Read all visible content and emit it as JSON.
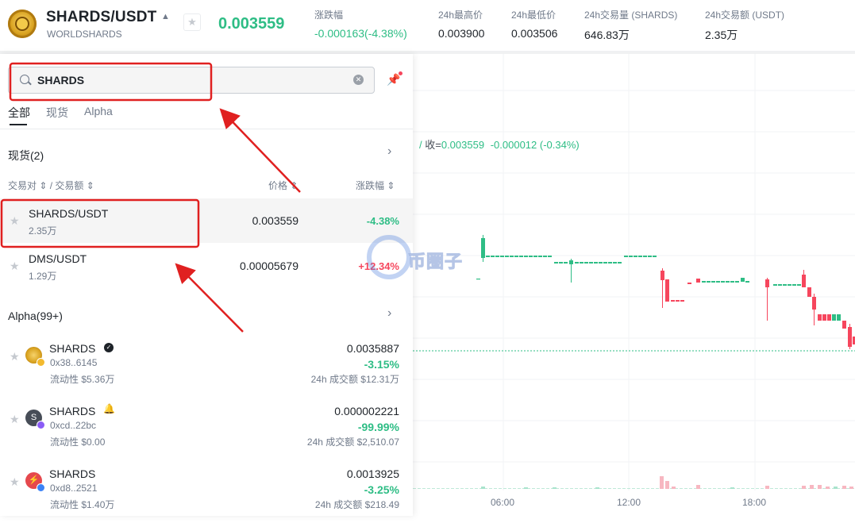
{
  "header": {
    "pair": "SHARDS/USDT",
    "project": "WORLDSHARDS",
    "last_price": "0.003559",
    "stats": [
      {
        "label": "涨跌幅",
        "value": "-0.000163(-4.38%)",
        "green": true
      },
      {
        "label": "24h最高价",
        "value": "0.003900"
      },
      {
        "label": "24h最低价",
        "value": "0.003506"
      },
      {
        "label": "24h交易量 (SHARDS)",
        "value": "646.83万"
      },
      {
        "label": "24h交易额 (USDT)",
        "value": "2.35万"
      }
    ]
  },
  "search": {
    "value": "SHARDS",
    "placeholder": ""
  },
  "tabs": [
    {
      "label": "全部",
      "active": true
    },
    {
      "label": "现货"
    },
    {
      "label": "Alpha"
    }
  ],
  "spot": {
    "title": "现货(2)",
    "headers": {
      "pair": "交易对 ⇕ / 交易额 ⇕",
      "price": "价格 ⇕",
      "change": "涨跌幅 ⇕"
    },
    "rows": [
      {
        "name": "SHARDS/USDT",
        "vol": "2.35万",
        "price": "0.003559",
        "change": "-4.38%",
        "dir": "green"
      },
      {
        "name": "DMS/USDT",
        "vol": "1.29万",
        "price": "0.00005679",
        "change": "+12.34%",
        "dir": "red"
      }
    ]
  },
  "alpha": {
    "title": "Alpha(99+)",
    "items": [
      {
        "name": "SHARDS",
        "addr": "0x38..6145",
        "liq": "流动性 $5.36万",
        "price": "0.0035887",
        "change": "-3.15%",
        "vol": "24h 成交额 $12.31万",
        "icon_color": "#d9a21f",
        "badge": "verified-icon"
      },
      {
        "name": "SHARDS",
        "addr": "0xcd..22bc",
        "liq": "流动性 $0.00",
        "price": "0.000002221",
        "change": "-99.99%",
        "vol": "24h 成交额 $2,510.07",
        "icon_color": "#474d57",
        "icon_letter": "S",
        "badge": "bell-icon"
      },
      {
        "name": "SHARDS",
        "addr": "0xd8..2521",
        "liq": "流动性 $1.40万",
        "price": "0.0013925",
        "change": "-3.25%",
        "vol": "24h 成交额 $218.49",
        "icon_color": "#e5484d"
      }
    ]
  },
  "chart": {
    "ohlc_label": "收=",
    "close": "0.003559",
    "change": "-0.000012 (-0.34%)",
    "x_ticks": [
      "06:00",
      "12:00",
      "18:00"
    ]
  },
  "watermark": {
    "text": "币圈子"
  }
}
